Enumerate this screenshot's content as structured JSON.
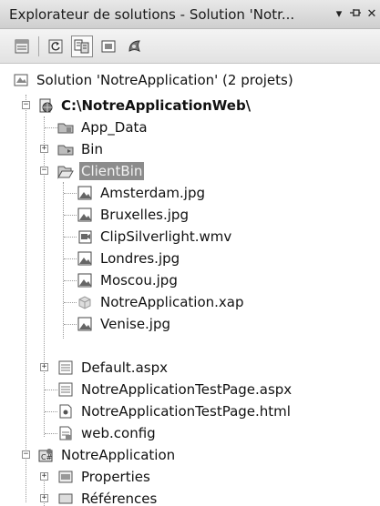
{
  "window": {
    "title": "Explorateur de solutions - Solution 'Notr...",
    "dropdown_glyph": "▾",
    "pin_glyph": "ᵠ",
    "close_glyph": "✕"
  },
  "toolbar": {
    "buttons": [
      {
        "icon": "properties-icon"
      },
      {
        "icon": "refresh-icon"
      },
      {
        "icon": "show-all-files-icon",
        "active": true
      },
      {
        "icon": "view-code-icon"
      },
      {
        "icon": "silverlight-icon"
      }
    ]
  },
  "tree": {
    "solution": "Solution 'NotreApplication' (2 projets)",
    "web_project": "C:\\NotreApplicationWeb\\",
    "app_data": "App_Data",
    "bin": "Bin",
    "clientbin": "ClientBin",
    "clientbin_items": [
      "Amsterdam.jpg",
      "Bruxelles.jpg",
      "ClipSilverlight.wmv",
      "Londres.jpg",
      "Moscou.jpg",
      "NotreApplication.xap",
      "Venise.jpg"
    ],
    "default_aspx": "Default.aspx",
    "testpage_aspx": "NotreApplicationTestPage.aspx",
    "testpage_html": "NotreApplicationTestPage.html",
    "web_config": "web.config",
    "app_project": "NotreApplication",
    "properties": "Properties",
    "references": "Références"
  },
  "expander_plus": "+",
  "expander_minus": "−"
}
